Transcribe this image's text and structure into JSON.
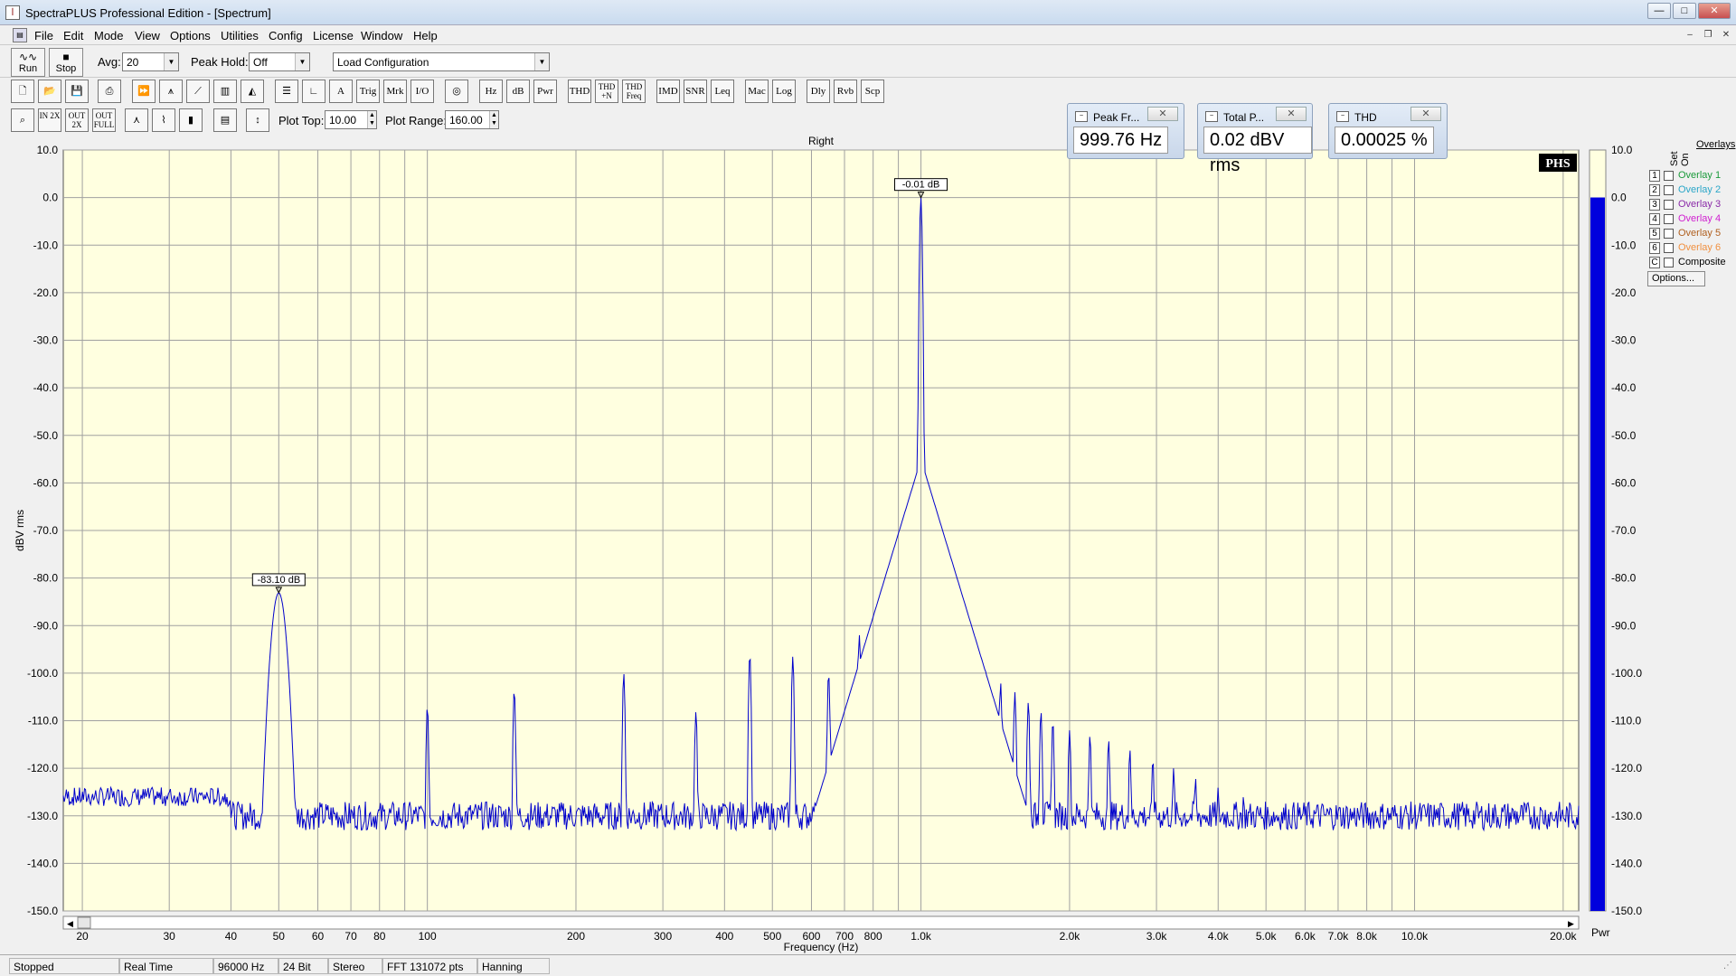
{
  "window": {
    "title": "SpectraPLUS Professional Edition - [Spectrum]"
  },
  "menu": [
    "File",
    "Edit",
    "Mode",
    "View",
    "Options",
    "Utilities",
    "Config",
    "License",
    "Window",
    "Help"
  ],
  "toolbar": {
    "run_label": "Run",
    "stop_label": "Stop",
    "avg_label": "Avg:",
    "avg_value": "20",
    "peak_hold_label": "Peak Hold:",
    "peak_hold_value": "Off",
    "config_value": "Load Configuration",
    "plot_top_label": "Plot Top:",
    "plot_top_value": "10.00",
    "plot_range_label": "Plot Range:",
    "plot_range_value": "160.00",
    "buttons_row2": [
      "Trig",
      "Mrk",
      "I/O",
      "Hz",
      "dB",
      "Pwr",
      "THD",
      "THD +N",
      "THD Freq",
      "IMD",
      "SNR",
      "Leq",
      "Mac",
      "Log",
      "Dly",
      "Rvb",
      "Scp"
    ],
    "buttons_row3_zoom": [
      "IN 2X",
      "OUT 2X",
      "OUT FULL"
    ]
  },
  "meters": [
    {
      "title": "Peak Fr...",
      "value": "999.76 Hz"
    },
    {
      "title": "Total P...",
      "value": "0.02 dBV rms"
    },
    {
      "title": "THD",
      "value": "0.00025 %"
    }
  ],
  "overlays": {
    "title": "Overlays",
    "set_label": "Set",
    "on_label": "On",
    "items": [
      {
        "num": "1",
        "label": "Overlay 1",
        "color": "#1a9a3a"
      },
      {
        "num": "2",
        "label": "Overlay 2",
        "color": "#2aa6c8"
      },
      {
        "num": "3",
        "label": "Overlay 3",
        "color": "#8a2aa8"
      },
      {
        "num": "4",
        "label": "Overlay 4",
        "color": "#d020d0"
      },
      {
        "num": "5",
        "label": "Overlay 5",
        "color": "#b06020"
      },
      {
        "num": "6",
        "label": "Overlay 6",
        "color": "#f09040"
      },
      {
        "num": "C",
        "label": "Composite",
        "color": "#000000"
      }
    ],
    "options_label": "Options..."
  },
  "status": [
    "Stopped",
    "Real Time",
    "96000 Hz",
    "24 Bit",
    "Stereo",
    "FFT 131072 pts",
    "Hanning"
  ],
  "colors": {
    "plot_bg": "#ffffe0",
    "trace": "#0000cc",
    "grid": "#a0a0a0",
    "bar": "#0000dd"
  },
  "chart_data": {
    "type": "line",
    "title": "Right",
    "xlabel": "Frequency (Hz)",
    "ylabel": "dBV rms",
    "x_scale": "log",
    "xlim": [
      18.3,
      21500
    ],
    "ylim": [
      -150,
      10
    ],
    "yticks": [
      10,
      0,
      -10,
      -20,
      -30,
      -40,
      -50,
      -60,
      -70,
      -80,
      -90,
      -100,
      -110,
      -120,
      -130,
      -140,
      -150
    ],
    "ytick_labels": [
      "10.0",
      "0.0",
      "-10.0",
      "-20.0",
      "-30.0",
      "-40.0",
      "-50.0",
      "-60.0",
      "-70.0",
      "-80.0",
      "-90.0",
      "-100.0",
      "-110.0",
      "-120.0",
      "-130.0",
      "-140.0",
      "-150.0"
    ],
    "xticks": [
      20,
      30,
      40,
      50,
      60,
      70,
      80,
      100,
      200,
      300,
      400,
      500,
      600,
      700,
      800,
      1000,
      2000,
      3000,
      4000,
      5000,
      6000,
      7000,
      8000,
      10000,
      20000
    ],
    "xtick_labels": [
      "20",
      "30",
      "40",
      "50",
      "60",
      "70",
      "80",
      "100",
      "200",
      "300",
      "400",
      "500",
      "600",
      "700",
      "800",
      "1.0k",
      "2.0k",
      "3.0k",
      "4.0k",
      "5.0k",
      "6.0k",
      "7.0k",
      "8.0k",
      "10.0k",
      "20.0k"
    ],
    "peaks": [
      {
        "x": 50,
        "y": -83.1
      },
      {
        "x": 100,
        "y": -107
      },
      {
        "x": 150,
        "y": -103.5
      },
      {
        "x": 250,
        "y": -100
      },
      {
        "x": 350,
        "y": -108
      },
      {
        "x": 450,
        "y": -96
      },
      {
        "x": 550,
        "y": -96.5
      },
      {
        "x": 650,
        "y": -100
      },
      {
        "x": 750,
        "y": -92
      },
      {
        "x": 850,
        "y": -92.5
      },
      {
        "x": 950,
        "y": -84
      },
      {
        "x": 999.76,
        "y": -0.01
      },
      {
        "x": 1050,
        "y": -85
      },
      {
        "x": 1150,
        "y": -93
      },
      {
        "x": 1250,
        "y": -96
      },
      {
        "x": 1350,
        "y": -99
      },
      {
        "x": 1450,
        "y": -102
      },
      {
        "x": 1550,
        "y": -104
      },
      {
        "x": 1650,
        "y": -106
      },
      {
        "x": 1750,
        "y": -108
      },
      {
        "x": 1850,
        "y": -110
      },
      {
        "x": 2000,
        "y": -112
      },
      {
        "x": 2200,
        "y": -113
      },
      {
        "x": 2400,
        "y": -114
      },
      {
        "x": 2650,
        "y": -116
      },
      {
        "x": 2950,
        "y": -118
      },
      {
        "x": 3250,
        "y": -120
      },
      {
        "x": 3600,
        "y": -122
      },
      {
        "x": 4000,
        "y": -124
      },
      {
        "x": 4500,
        "y": -126
      }
    ],
    "noise_floor": -130,
    "markers": [
      {
        "x": 50,
        "y": -83.1,
        "label": "-83.10 dB"
      },
      {
        "x": 999.76,
        "y": -0.01,
        "label": "-0.01 dB"
      }
    ],
    "logo": "PHS",
    "bar_label": "Pwr",
    "bar_value": 0.02,
    "bar_ticks": [
      "10.0",
      "0.0",
      "-10.0",
      "-20.0",
      "-30.0",
      "-40.0",
      "-50.0",
      "-60.0",
      "-70.0",
      "-80.0",
      "-90.0",
      "-100.0",
      "-110.0",
      "-120.0",
      "-130.0",
      "-140.0",
      "-150.0"
    ]
  }
}
